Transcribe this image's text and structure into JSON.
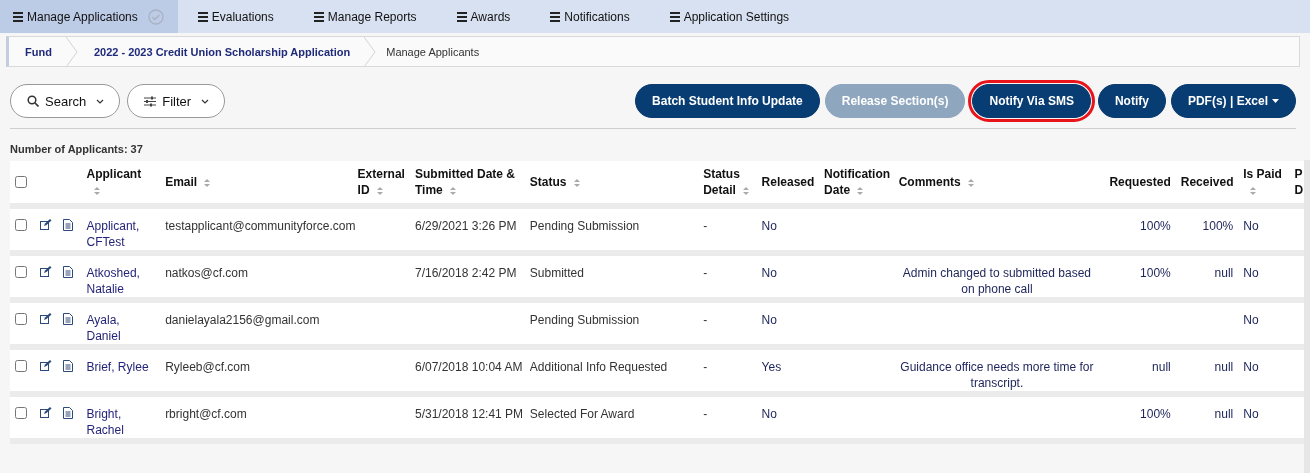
{
  "nav_tabs": [
    {
      "label": "Manage Applications",
      "selected": true
    },
    {
      "label": "Evaluations",
      "selected": false
    },
    {
      "label": "Manage Reports",
      "selected": false
    },
    {
      "label": "Awards",
      "selected": false
    },
    {
      "label": "Notifications",
      "selected": false
    },
    {
      "label": "Application Settings",
      "selected": false
    }
  ],
  "breadcrumb": [
    "Fund",
    "2022 - 2023 Credit Union Scholarship Application",
    "Manage Applicants"
  ],
  "toolbar": {
    "search": "Search",
    "filter": "Filter",
    "buttons": [
      {
        "label": "Batch Student Info Update",
        "disabled": false,
        "highlighted": false,
        "caret": false
      },
      {
        "label": "Release Section(s)",
        "disabled": true,
        "highlighted": false,
        "caret": false
      },
      {
        "label": "Notify Via SMS",
        "disabled": false,
        "highlighted": true,
        "caret": false
      },
      {
        "label": "Notify",
        "disabled": false,
        "highlighted": false,
        "caret": false
      },
      {
        "label": "PDF(s) | Excel",
        "disabled": false,
        "highlighted": false,
        "caret": true
      }
    ]
  },
  "applicant_count": "Number of Applicants: 37",
  "table": {
    "select_all_checked": false,
    "columns": [
      {
        "label": "Applicant",
        "sortable": true
      },
      {
        "label": "Email",
        "sortable": true
      },
      {
        "label": "External ID",
        "sortable": true
      },
      {
        "label": "Submitted Date & Time",
        "sortable": true
      },
      {
        "label": "Status",
        "sortable": true
      },
      {
        "label": "Status Detail",
        "sortable": true
      },
      {
        "label": "Released",
        "sortable": false
      },
      {
        "label": "Notification Date",
        "sortable": true
      },
      {
        "label": "Comments",
        "sortable": true
      },
      {
        "label": "Requested",
        "sortable": false
      },
      {
        "label": "Received",
        "sortable": false
      },
      {
        "label": "Is Paid",
        "sortable": true
      },
      {
        "label": "P D",
        "sortable": false
      }
    ],
    "rows": [
      {
        "checked": false,
        "applicant": "Applicant, CFTest",
        "email": "testapplicant@communityforce.com",
        "submitted": "6/29/2021 3:26 PM",
        "status": "Pending Submission",
        "status_detail": "-",
        "released": "No",
        "requested": "100%",
        "received": "100%",
        "is_paid": "No"
      },
      {
        "checked": false,
        "applicant": "Atkoshed, Natalie",
        "email": "natkos@cf.com",
        "submitted": "7/16/2018 2:42 PM",
        "status": "Submitted",
        "status_detail": "-",
        "released": "No",
        "comments": "Admin changed to submitted based on phone call",
        "requested": "100%",
        "received": "null",
        "is_paid": "No"
      },
      {
        "checked": false,
        "applicant": "Ayala, Daniel",
        "email": "danielayala2156@gmail.com",
        "status": "Pending Submission",
        "status_detail": "-",
        "released": "No",
        "is_paid": "No"
      },
      {
        "checked": false,
        "applicant": "Brief, Rylee",
        "email": "Ryleeb@cf.com",
        "submitted": "6/07/2018 10:04 AM",
        "status": "Additional Info Requested",
        "status_detail": "-",
        "released": "Yes",
        "comments": "Guidance office needs more time for transcript.",
        "requested": "null",
        "received": "null",
        "is_paid": "No"
      },
      {
        "checked": false,
        "applicant": "Bright, Rachel",
        "email": "rbright@cf.com",
        "submitted": "5/31/2018 12:41 PM",
        "status": "Selected For Award",
        "status_detail": "-",
        "released": "No",
        "requested": "100%",
        "received": "null",
        "is_paid": "No"
      }
    ]
  }
}
